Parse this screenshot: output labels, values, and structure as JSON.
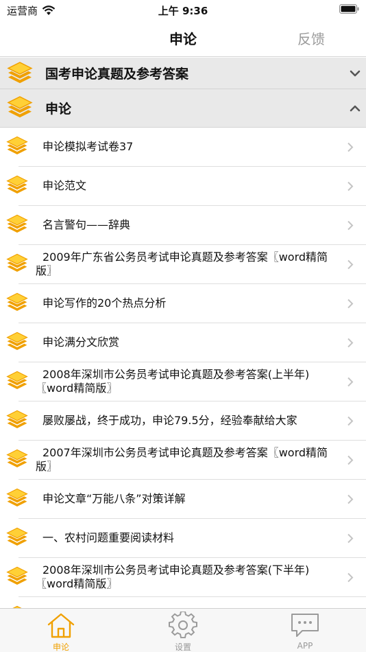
{
  "status_bar": {
    "carrier": "运营商",
    "time": "上午 9:36"
  },
  "nav": {
    "title": "申论",
    "feedback": "反馈"
  },
  "colors": {
    "accent": "#f0a000",
    "icon_light": "#ffd036",
    "header_bg": "#e9e9e9"
  },
  "sections": [
    {
      "title": "国考申论真题及参考答案",
      "state": "collapsed",
      "icon": "layers-icon"
    },
    {
      "title": "申论",
      "state": "expanded",
      "icon": "layers-icon"
    }
  ],
  "items": [
    {
      "label": "申论模拟考试卷37"
    },
    {
      "label": "申论范文"
    },
    {
      "label": "名言警句——辞典"
    },
    {
      "label": "2009年广东省公务员考试申论真题及参考答案〖word精简版〗"
    },
    {
      "label": "申论写作的20个热点分析"
    },
    {
      "label": "申论满分文欣赏"
    },
    {
      "label": "2008年深圳市公务员考试申论真题及参考答案(上半年)〖word精简版〗"
    },
    {
      "label": "屡败屡战，终于成功，申论79.5分，经验奉献给大家"
    },
    {
      "label": "2007年深圳市公务员考试申论真题及参考答案〖word精简版〗"
    },
    {
      "label": "申论文章“万能八条”对策详解"
    },
    {
      "label": "一、农村问题重要阅读材料"
    },
    {
      "label": "2008年深圳市公务员考试申论真题及参考答案(下半年)〖word精简版〗"
    },
    {
      "label": ""
    }
  ],
  "tabs": [
    {
      "label": "申论",
      "icon": "home-icon",
      "active": true
    },
    {
      "label": "设置",
      "icon": "gear-icon",
      "active": false
    },
    {
      "label": "APP",
      "icon": "chat-bubble-icon",
      "active": false
    }
  ]
}
